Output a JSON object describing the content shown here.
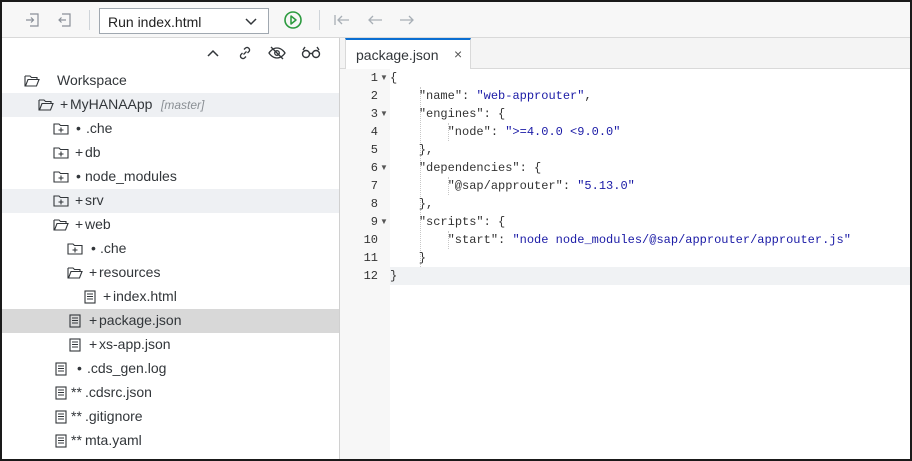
{
  "toolbar": {
    "run_config": "Run index.html",
    "icons": [
      "export-icon",
      "import-icon",
      "chevron-down-icon",
      "play-icon",
      "step-back-icon",
      "back-icon",
      "forward-icon"
    ]
  },
  "explorer": {
    "actions": [
      "collapse-all-icon",
      "link-icon",
      "hide-icon",
      "glasses-icon"
    ],
    "tree": [
      {
        "label": "Workspace",
        "marker": "",
        "icon": "folder-open-icon"
      },
      {
        "label": "MyHANAApp",
        "marker": "+",
        "icon": "folder-open-icon",
        "branch": "[master]"
      },
      {
        "label": ".che",
        "marker": "•",
        "icon": "folder-plus-icon"
      },
      {
        "label": "db",
        "marker": "+",
        "icon": "folder-plus-icon"
      },
      {
        "label": "node_modules",
        "marker": "•",
        "icon": "folder-plus-icon"
      },
      {
        "label": "srv",
        "marker": "+",
        "icon": "folder-plus-icon"
      },
      {
        "label": "web",
        "marker": "+",
        "icon": "folder-open-icon"
      },
      {
        "label": ".che",
        "marker": "•",
        "icon": "folder-plus-icon"
      },
      {
        "label": "resources",
        "marker": "+",
        "icon": "folder-open-icon"
      },
      {
        "label": "index.html",
        "marker": "+",
        "icon": "file-icon"
      },
      {
        "label": "package.json",
        "marker": "+",
        "icon": "file-icon"
      },
      {
        "label": "xs-app.json",
        "marker": "+",
        "icon": "file-icon"
      },
      {
        "label": ".cds_gen.log",
        "marker": "•",
        "icon": "file-icon"
      },
      {
        "label": ".cdsrc.json",
        "marker": "**",
        "icon": "file-icon"
      },
      {
        "label": ".gitignore",
        "marker": "**",
        "icon": "file-icon"
      },
      {
        "label": "mta.yaml",
        "marker": "**",
        "icon": "file-icon"
      }
    ]
  },
  "editor": {
    "tab_label": "package.json",
    "tab_close": "×",
    "line_numbers": [
      "1",
      "2",
      "3",
      "4",
      "5",
      "6",
      "7",
      "8",
      "9",
      "10",
      "11",
      "12"
    ],
    "lines": [
      "{",
      "    \"name\": \"web-approuter\",",
      "    \"engines\": {",
      "        \"node\": \">=4.0.0 <9.0.0\"",
      "    },",
      "    \"dependencies\": {",
      "        \"@sap/approuter\": \"5.13.0\"",
      "    },",
      "    \"scripts\": {",
      "        \"start\": \"node node_modules/@sap/approuter/approuter.js\"",
      "    }",
      "}"
    ]
  }
}
